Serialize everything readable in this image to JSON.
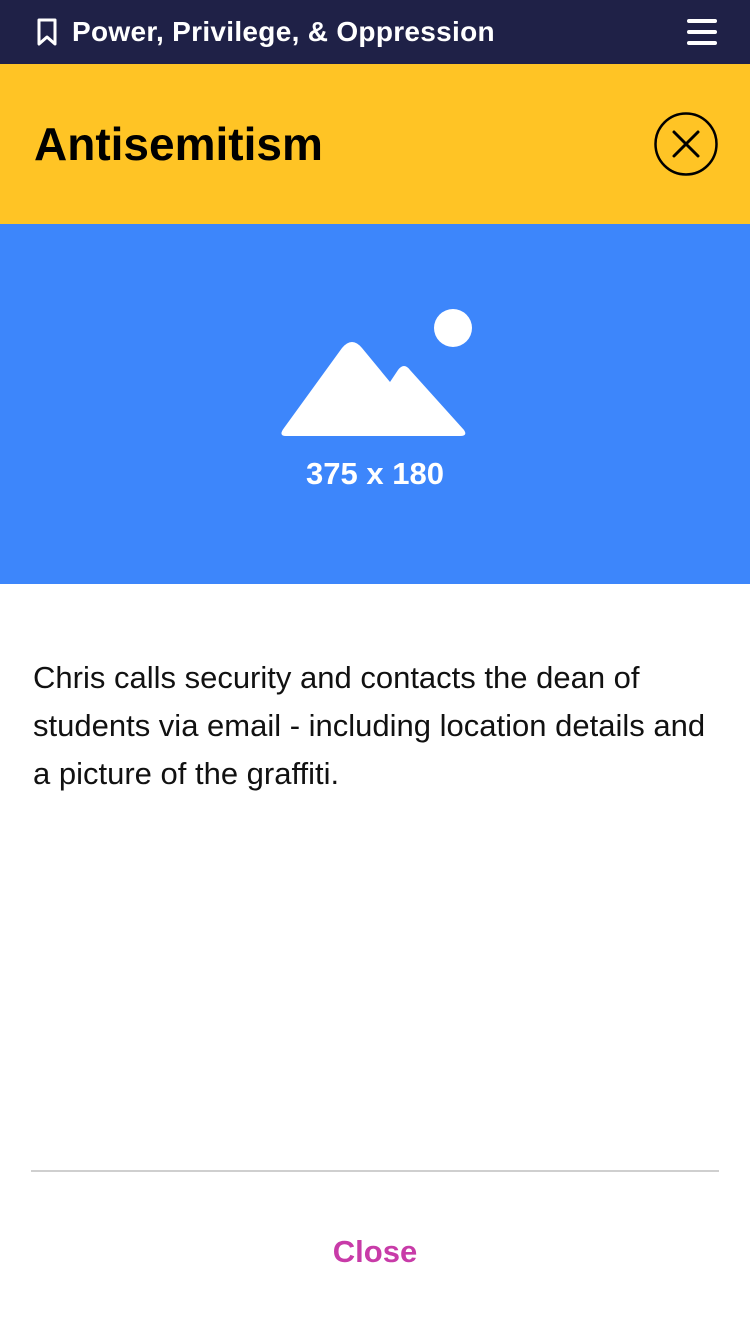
{
  "topbar": {
    "title": "Power, Privilege, & Oppression",
    "bookmark_icon": "bookmark-icon",
    "menu_icon": "hamburger-menu-icon",
    "background": "#1f2147"
  },
  "header": {
    "title": "Antisemitism",
    "close_icon": "close-circle-icon",
    "background": "#ffc425"
  },
  "image_placeholder": {
    "label": "375 x 180",
    "icon": "image-icon",
    "background": "#3d86fb"
  },
  "content": {
    "text": "Chris calls security and contacts the dean of students via email - including location details and a picture of the graffiti."
  },
  "footer": {
    "close_label": "Close",
    "accent": "#c83ba8"
  }
}
